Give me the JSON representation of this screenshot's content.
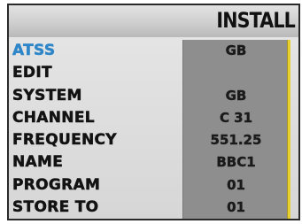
{
  "header": {
    "title": "INSTALL"
  },
  "menu": {
    "rows": [
      {
        "label": "ATSS",
        "value": "GB"
      },
      {
        "label": "EDIT",
        "value": ""
      },
      {
        "label": "SYSTEM",
        "value": "GB"
      },
      {
        "label": "CHANNEL",
        "value": "C 31"
      },
      {
        "label": "FREQUENCY",
        "value": "551.25"
      },
      {
        "label": "NAME",
        "value": "BBC1"
      },
      {
        "label": "PROGRAM",
        "value": "01"
      },
      {
        "label": "STORE TO",
        "value": "01"
      }
    ],
    "selected_index": 0
  },
  "colors": {
    "highlight": "#2e86c8",
    "value_panel": "#8e8e8e",
    "scroll_indicator": "#e6cf2e"
  }
}
